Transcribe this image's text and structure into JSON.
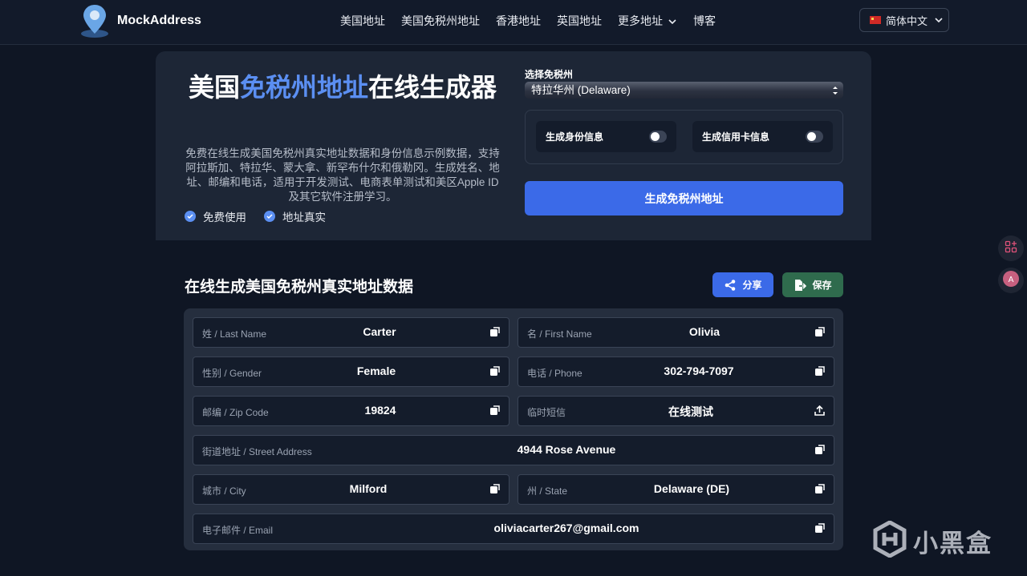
{
  "header": {
    "logo_text": "MockAddress",
    "nav": [
      "美国地址",
      "美国免税州地址",
      "香港地址",
      "英国地址",
      "更多地址",
      "博客"
    ],
    "language": "简体中文"
  },
  "hero": {
    "title_prefix": "美国",
    "title_highlight": "免税州地址",
    "title_suffix": "在线生成器",
    "description": "免费在线生成美国免税州真实地址数据和身份信息示例数据，支持阿拉斯加、特拉华、蒙大拿、新罕布什尔和俄勒冈。生成姓名、地址、邮编和电话，适用于开发测试、电商表单测试和美区Apple ID及其它软件注册学习。",
    "features": [
      "免费使用",
      "地址真实"
    ],
    "select_label": "选择免税州",
    "select_value": "特拉华州 (Delaware)",
    "toggle_identity": "生成身份信息",
    "toggle_credit": "生成信用卡信息",
    "generate_button": "生成免税州地址"
  },
  "results": {
    "title": "在线生成美国免税州真实地址数据",
    "share_label": "分享",
    "save_label": "保存",
    "fields": {
      "last_name": {
        "label": "姓 / Last Name",
        "value": "Carter"
      },
      "first_name": {
        "label": "名 / First Name",
        "value": "Olivia"
      },
      "gender": {
        "label": "性别 / Gender",
        "value": "Female"
      },
      "phone": {
        "label": "电话 / Phone",
        "value": "302-794-7097"
      },
      "zip": {
        "label": "邮编 / Zip Code",
        "value": "19824"
      },
      "sms": {
        "label": "临时短信",
        "value": "在线测试"
      },
      "street": {
        "label": "街道地址 / Street Address",
        "value": "4944 Rose Avenue"
      },
      "city": {
        "label": "城市 / City",
        "value": "Milford"
      },
      "state": {
        "label": "州 / State",
        "value": "Delaware (DE)"
      },
      "email": {
        "label": "电子邮件 / Email",
        "value": "oliviacarter267@gmail.com"
      }
    }
  },
  "watermark": "小黑盒",
  "colors": {
    "accent": "#3b6ae8",
    "highlight": "#5b8ff2",
    "save_green": "#2f6b4d",
    "background": "#0f1624"
  }
}
